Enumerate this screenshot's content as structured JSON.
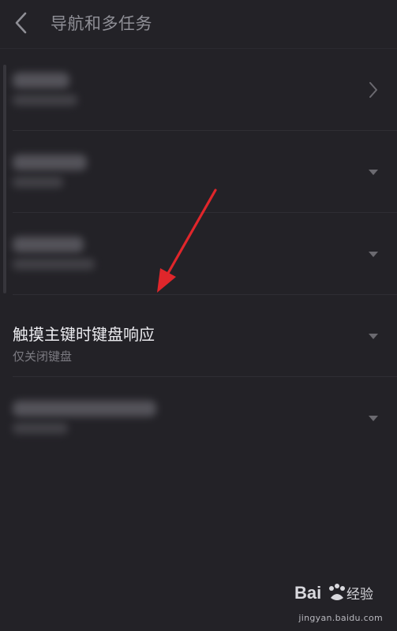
{
  "header": {
    "title": "导航和多任务",
    "back_icon": "chevron-left-icon"
  },
  "settings": {
    "items": [
      {
        "title": "",
        "subtitle": "",
        "control": "chevron-right-icon",
        "blurred": true
      },
      {
        "title": "",
        "subtitle": "",
        "control": "dropdown-triangle-icon",
        "blurred": true
      },
      {
        "title": "",
        "subtitle": "",
        "control": "dropdown-triangle-icon",
        "blurred": true
      },
      {
        "title": "触摸主键时键盘响应",
        "subtitle": "仅关闭键盘",
        "control": "dropdown-triangle-icon",
        "blurred": false
      },
      {
        "title": "",
        "subtitle": "",
        "control": "dropdown-triangle-icon",
        "blurred": true
      }
    ]
  },
  "annotation": {
    "arrow_color": "#e0262b"
  },
  "watermark": {
    "brand": "Baidu经验",
    "domain": "jingyan.baidu.com"
  },
  "colors": {
    "background": "#232227",
    "title_text": "#8f8f96",
    "primary_text": "#ececf0",
    "secondary_text": "#7c7b82",
    "icon": "#6b6a70"
  }
}
